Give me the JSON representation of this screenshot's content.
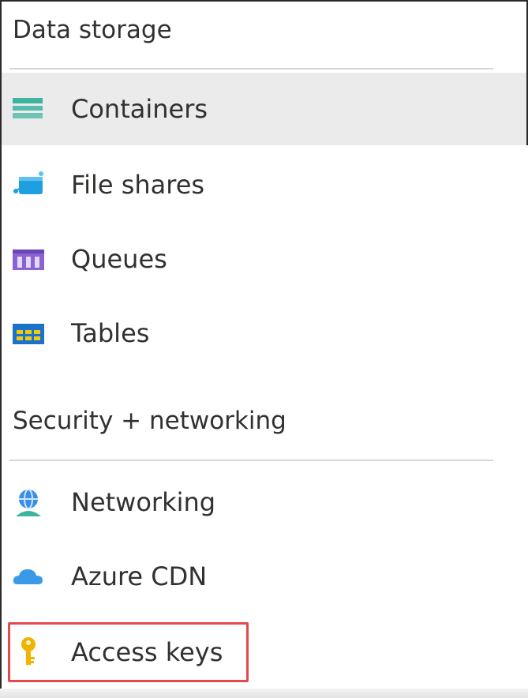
{
  "sections": {
    "data_storage": {
      "title": "Data storage",
      "items": [
        {
          "label": "Containers",
          "icon": "containers-icon",
          "selected": true
        },
        {
          "label": "File shares",
          "icon": "file-shares-icon"
        },
        {
          "label": "Queues",
          "icon": "queues-icon"
        },
        {
          "label": "Tables",
          "icon": "tables-icon"
        }
      ]
    },
    "security": {
      "title": "Security + networking",
      "items": [
        {
          "label": "Networking",
          "icon": "networking-icon"
        },
        {
          "label": "Azure CDN",
          "icon": "azure-cdn-icon"
        },
        {
          "label": "Access keys",
          "icon": "key-icon",
          "highlighted": true
        }
      ]
    }
  },
  "colors": {
    "selected_bg": "#ebebeb",
    "highlight_border": "#e5484d",
    "containers": "#3cb4a0",
    "file_shares": "#1e9fe0",
    "queues": "#8a63d2",
    "tables": "#1a73c8",
    "networking": "#3a8ee6",
    "azure_cdn": "#3b9ae8",
    "key": "#f0b400"
  }
}
